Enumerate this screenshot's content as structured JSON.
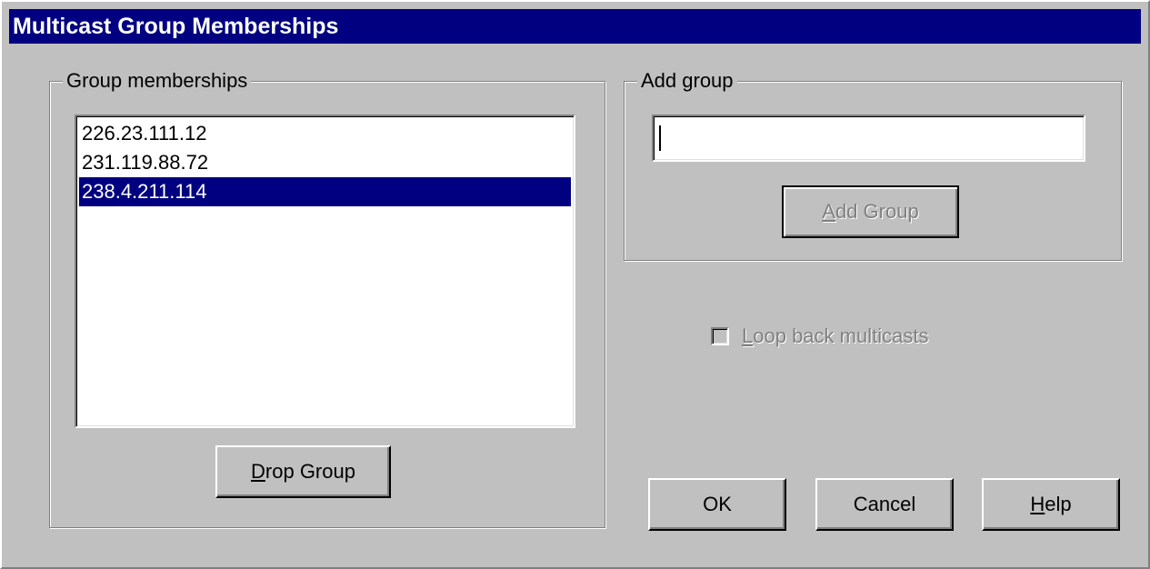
{
  "window": {
    "title": "Multicast Group Memberships"
  },
  "memberships": {
    "legend": "Group memberships",
    "items": [
      "226.23.111.12",
      "231.119.88.72",
      "238.4.211.114"
    ],
    "selected_index": 2,
    "drop_button": {
      "mnemonic": "D",
      "rest": "rop Group"
    }
  },
  "add_group": {
    "legend": "Add group",
    "input_value": "",
    "add_button": {
      "mnemonic": "A",
      "rest": "dd Group",
      "enabled": false
    }
  },
  "loopback": {
    "mnemonic": "L",
    "rest": "oop back multicasts",
    "checked": false,
    "enabled": false
  },
  "buttons": {
    "ok": "OK",
    "cancel": "Cancel",
    "help": {
      "mnemonic": "H",
      "rest": "elp"
    }
  },
  "colors": {
    "face": "#c0c0c0",
    "titlebar": "#000080",
    "selection": "#000080",
    "disabled_text": "#808080"
  }
}
